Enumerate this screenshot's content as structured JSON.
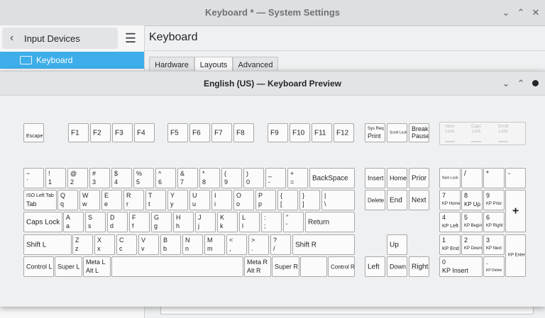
{
  "window": {
    "title": "Keyboard * — System Settings",
    "min_icon": "⌄",
    "max_icon": "⌃",
    "close_icon": "✕"
  },
  "sidebar": {
    "back_label": "Input Devices",
    "back_icon": "‹",
    "menu_icon": "☰",
    "selected_item": "Keyboard"
  },
  "page": {
    "title": "Keyboard",
    "tabs": [
      "Hardware",
      "Layouts",
      "Advanced"
    ],
    "active_tab": "Layouts"
  },
  "dialog": {
    "title": "English (US) — Keyboard Preview",
    "min_icon": "⌄",
    "max_icon": "⌃"
  },
  "leds": [
    "Num\nLock",
    "Caps\nLock",
    "Scroll\nLock"
  ],
  "keys": [
    {
      "id": "escape",
      "t": "",
      "b": "Escape",
      "fs": 7
    },
    {
      "id": "f1",
      "t": "",
      "b": "F1",
      "fs": 10,
      "mid": 1
    },
    {
      "id": "f2",
      "t": "",
      "b": "F2",
      "fs": 10,
      "mid": 1
    },
    {
      "id": "f3",
      "t": "",
      "b": "F3",
      "fs": 10,
      "mid": 1
    },
    {
      "id": "f4",
      "t": "",
      "b": "F4",
      "fs": 10,
      "mid": 1
    },
    {
      "id": "f5",
      "t": "",
      "b": "F5",
      "fs": 10,
      "mid": 1
    },
    {
      "id": "f6",
      "t": "",
      "b": "F6",
      "fs": 10,
      "mid": 1
    },
    {
      "id": "f7",
      "t": "",
      "b": "F7",
      "fs": 10,
      "mid": 1
    },
    {
      "id": "f8",
      "t": "",
      "b": "F8",
      "fs": 10,
      "mid": 1
    },
    {
      "id": "f9",
      "t": "",
      "b": "F9",
      "fs": 10,
      "mid": 1
    },
    {
      "id": "f10",
      "t": "",
      "b": "F10",
      "fs": 10,
      "mid": 1
    },
    {
      "id": "f11",
      "t": "",
      "b": "F11",
      "fs": 10,
      "mid": 1
    },
    {
      "id": "f12",
      "t": "",
      "b": "F12",
      "fs": 10,
      "mid": 1
    },
    {
      "id": "print",
      "t": "Sys Req",
      "b": "Print",
      "fs": 9,
      "tfs": 6
    },
    {
      "id": "scroll-lock",
      "t": "",
      "b": "Scroll Lock",
      "fs": 5,
      "mid": 1
    },
    {
      "id": "pause",
      "t": "Break",
      "b": "Pause",
      "fs": 9
    },
    {
      "id": "tilde",
      "t": "~",
      "b": "`",
      "fs": 9
    },
    {
      "id": "k1",
      "t": "!",
      "b": "1",
      "fs": 9
    },
    {
      "id": "k2",
      "t": "@",
      "b": "2",
      "fs": 9
    },
    {
      "id": "k3",
      "t": "#",
      "b": "3",
      "fs": 9
    },
    {
      "id": "k4",
      "t": "$",
      "b": "4",
      "fs": 9
    },
    {
      "id": "k5",
      "t": "%",
      "b": "5",
      "fs": 9
    },
    {
      "id": "k6",
      "t": "^",
      "b": "6",
      "fs": 9
    },
    {
      "id": "k7",
      "t": "&",
      "b": "7",
      "fs": 9
    },
    {
      "id": "k8",
      "t": "*",
      "b": "8",
      "fs": 9
    },
    {
      "id": "k9",
      "t": "(",
      "b": "9",
      "fs": 9
    },
    {
      "id": "k0",
      "t": ")",
      "b": "0",
      "fs": 9
    },
    {
      "id": "minus",
      "t": "_",
      "b": "-",
      "fs": 9
    },
    {
      "id": "equal",
      "t": "+",
      "b": "=",
      "fs": 9
    },
    {
      "id": "backspace",
      "t": "",
      "b": "BackSpace",
      "fs": 10,
      "mid": 1
    },
    {
      "id": "insert",
      "t": "",
      "b": "Insert",
      "fs": 9,
      "mid": 1
    },
    {
      "id": "home",
      "t": "",
      "b": "Home",
      "fs": 9,
      "mid": 1
    },
    {
      "id": "prior",
      "t": "",
      "b": "Prior",
      "fs": 10,
      "mid": 1
    },
    {
      "id": "num-lock",
      "t": "",
      "b": "Num Lock",
      "fs": 5,
      "mid": 1
    },
    {
      "id": "kp-divide",
      "t": "/",
      "b": "",
      "fs": 10
    },
    {
      "id": "kp-multiply",
      "t": "*",
      "b": "",
      "fs": 10
    },
    {
      "id": "kp-minus",
      "t": "-",
      "b": "",
      "fs": 10
    },
    {
      "id": "tab",
      "t": "ISO Left Tab",
      "b": "Tab",
      "fs": 9,
      "tfs": 7
    },
    {
      "id": "q",
      "t": "Q",
      "b": "q",
      "fs": 9
    },
    {
      "id": "w",
      "t": "W",
      "b": "w",
      "fs": 9
    },
    {
      "id": "e",
      "t": "E",
      "b": "e",
      "fs": 9
    },
    {
      "id": "r",
      "t": "R",
      "b": "r",
      "fs": 9
    },
    {
      "id": "t",
      "t": "T",
      "b": "t",
      "fs": 9
    },
    {
      "id": "y",
      "t": "Y",
      "b": "y",
      "fs": 9
    },
    {
      "id": "u",
      "t": "U",
      "b": "u",
      "fs": 9
    },
    {
      "id": "i",
      "t": "I",
      "b": "i",
      "fs": 9
    },
    {
      "id": "o",
      "t": "O",
      "b": "o",
      "fs": 9
    },
    {
      "id": "p",
      "t": "P",
      "b": "p",
      "fs": 9
    },
    {
      "id": "lbracket",
      "t": "{",
      "b": "[",
      "fs": 9
    },
    {
      "id": "rbracket",
      "t": "}",
      "b": "]",
      "fs": 9
    },
    {
      "id": "backslash",
      "t": "|",
      "b": "\\",
      "fs": 9
    },
    {
      "id": "delete",
      "t": "",
      "b": "Delete",
      "fs": 8,
      "mid": 1
    },
    {
      "id": "end",
      "t": "",
      "b": "End",
      "fs": 10,
      "mid": 1
    },
    {
      "id": "next",
      "t": "",
      "b": "Next",
      "fs": 10,
      "mid": 1
    },
    {
      "id": "kp7",
      "t": "7",
      "b": "KP Home",
      "fs": 9,
      "bfs": 6
    },
    {
      "id": "kp8",
      "t": "8",
      "b": "KP Up",
      "fs": 9,
      "bfs": 8
    },
    {
      "id": "kp9",
      "t": "9",
      "b": "KP Prior",
      "fs": 9,
      "bfs": 6
    },
    {
      "id": "kp-plus",
      "t": "",
      "b": "+",
      "fs": 16,
      "mid": 1
    },
    {
      "id": "capslock",
      "t": "",
      "b": "Caps Lock",
      "fs": 10,
      "mid": 1
    },
    {
      "id": "a",
      "t": "A",
      "b": "a",
      "fs": 9
    },
    {
      "id": "s",
      "t": "S",
      "b": "s",
      "fs": 9
    },
    {
      "id": "d",
      "t": "D",
      "b": "d",
      "fs": 9
    },
    {
      "id": "f",
      "t": "F",
      "b": "f",
      "fs": 9
    },
    {
      "id": "g",
      "t": "G",
      "b": "g",
      "fs": 9
    },
    {
      "id": "h",
      "t": "H",
      "b": "h",
      "fs": 9
    },
    {
      "id": "j",
      "t": "J",
      "b": "j",
      "fs": 9
    },
    {
      "id": "k",
      "t": "K",
      "b": "k",
      "fs": 9
    },
    {
      "id": "l",
      "t": "L",
      "b": "l",
      "fs": 9
    },
    {
      "id": "semicolon",
      "t": ":",
      "b": ";",
      "fs": 9
    },
    {
      "id": "quote",
      "t": "\"",
      "b": "'",
      "fs": 9
    },
    {
      "id": "return",
      "t": "",
      "b": "Return",
      "fs": 10,
      "mid": 1
    },
    {
      "id": "kp4",
      "t": "4",
      "b": "KP Left",
      "fs": 9,
      "bfs": 7
    },
    {
      "id": "kp5",
      "t": "5",
      "b": "KP Begin",
      "fs": 9,
      "bfs": 6
    },
    {
      "id": "kp6",
      "t": "6",
      "b": "KP Right",
      "fs": 9,
      "bfs": 6
    },
    {
      "id": "shift-l",
      "t": "",
      "b": "Shift L",
      "fs": 10,
      "mid": 1
    },
    {
      "id": "z",
      "t": "Z",
      "b": "z",
      "fs": 9
    },
    {
      "id": "x",
      "t": "X",
      "b": "x",
      "fs": 9
    },
    {
      "id": "c",
      "t": "C",
      "b": "c",
      "fs": 9
    },
    {
      "id": "v",
      "t": "V",
      "b": "v",
      "fs": 9
    },
    {
      "id": "b",
      "t": "B",
      "b": "b",
      "fs": 9
    },
    {
      "id": "n",
      "t": "N",
      "b": "n",
      "fs": 9
    },
    {
      "id": "m",
      "t": "M",
      "b": "m",
      "fs": 9
    },
    {
      "id": "comma",
      "t": "<",
      "b": ",",
      "fs": 9
    },
    {
      "id": "period",
      "t": ">",
      "b": ".",
      "fs": 9
    },
    {
      "id": "slash",
      "t": "?",
      "b": "/",
      "fs": 9
    },
    {
      "id": "shift-r",
      "t": "",
      "b": "Shift R",
      "fs": 10,
      "mid": 1
    },
    {
      "id": "up",
      "t": "",
      "b": "Up",
      "fs": 10,
      "mid": 1
    },
    {
      "id": "kp1",
      "t": "1",
      "b": "KP End",
      "fs": 9,
      "bfs": 7
    },
    {
      "id": "kp2",
      "t": "2",
      "b": "KP Down",
      "fs": 9,
      "bfs": 6
    },
    {
      "id": "kp3",
      "t": "3",
      "b": "KP Next",
      "fs": 9,
      "bfs": 6
    },
    {
      "id": "kp-enter",
      "t": "",
      "b": "KP Enter",
      "fs": 6,
      "mid": 1
    },
    {
      "id": "control-l",
      "t": "",
      "b": "Control L",
      "fs": 9,
      "mid": 1
    },
    {
      "id": "super-l",
      "t": "",
      "b": "Super L",
      "fs": 9,
      "mid": 1
    },
    {
      "id": "meta-l",
      "t": "Meta L",
      "b": "Alt L",
      "fs": 9
    },
    {
      "id": "space",
      "t": "",
      "b": "",
      "fs": 9
    },
    {
      "id": "meta-r",
      "t": "Meta R",
      "b": "Alt R",
      "fs": 9
    },
    {
      "id": "super-r",
      "t": "",
      "b": "Super R",
      "fs": 9,
      "mid": 1
    },
    {
      "id": "menu",
      "t": "",
      "b": "",
      "fs": 9
    },
    {
      "id": "control-r",
      "t": "",
      "b": "Control R",
      "fs": 8,
      "mid": 1
    },
    {
      "id": "left",
      "t": "",
      "b": "Left",
      "fs": 10,
      "mid": 1
    },
    {
      "id": "down",
      "t": "",
      "b": "Down",
      "fs": 9,
      "mid": 1
    },
    {
      "id": "right",
      "t": "",
      "b": "Right",
      "fs": 10,
      "mid": 1
    },
    {
      "id": "kp0",
      "t": "0",
      "b": "KP Insert",
      "fs": 9,
      "bfs": 9
    },
    {
      "id": "kp-decimal",
      "t": ".",
      "b": "KP Delete",
      "fs": 9,
      "bfs": 5
    }
  ]
}
